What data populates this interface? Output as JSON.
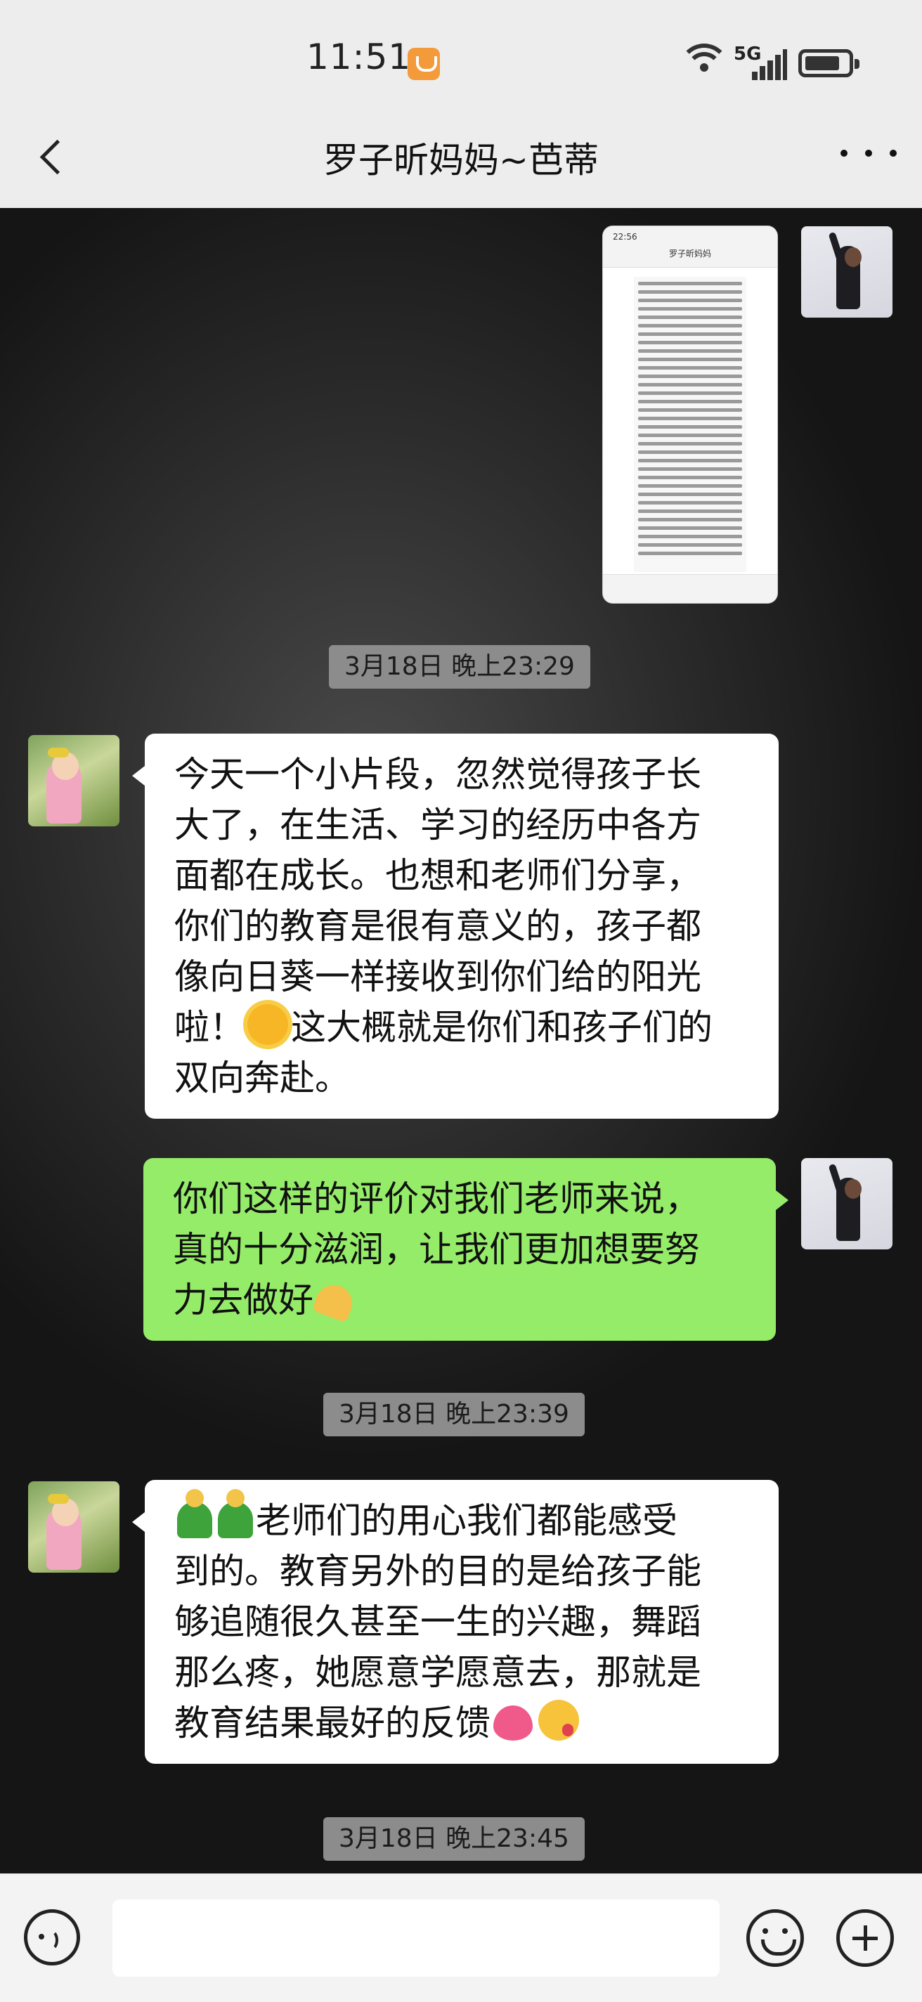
{
  "status_bar": {
    "time": "11:51",
    "network_label": "5G",
    "icons": [
      "clock-app-badge-icon",
      "wifi-icon",
      "signal-icon",
      "battery-icon"
    ]
  },
  "header": {
    "title": "罗子昕妈妈~芭蒂",
    "back_icon": "chevron-left-icon",
    "more_icon": "more-dots-icon"
  },
  "messages": [
    {
      "id": "m1",
      "side": "right",
      "type": "image",
      "image": {
        "time": "22:56",
        "title": "罗子昕妈妈"
      }
    },
    {
      "id": "t1",
      "type": "timestamp",
      "text": "3月18日 晚上23:29"
    },
    {
      "id": "m2",
      "side": "left",
      "type": "text",
      "lines": [
        "今天一个小片段，忽然觉得孩子长",
        "大了，在生活、学习的经历中各方",
        "面都在成长。也想和老师们分享，",
        "你们的教育是很有意义的，孩子都",
        "像向日葵一样接收到你们给的阳光",
        "啦！",
        "这大概就是你们和孩子们的",
        "双向奔赴。"
      ]
    },
    {
      "id": "m3",
      "side": "right",
      "type": "text",
      "lines": [
        "你们这样的评价对我们老师来说，",
        "真的十分滋润，让我们更加想要努",
        "力去做好"
      ]
    },
    {
      "id": "t2",
      "type": "timestamp",
      "text": "3月18日 晚上23:39"
    },
    {
      "id": "m4",
      "side": "left",
      "type": "text",
      "lines": [
        "老师们的用心我们都能感受",
        "到的。教育另外的目的是给孩子能",
        "够追随很久甚至一生的兴趣，舞蹈",
        "那么疼，她愿意学愿意去，那就是",
        "教育结果最好的反馈"
      ]
    },
    {
      "id": "t3",
      "type": "timestamp",
      "text": "3月18日 晚上23:45"
    }
  ],
  "input_bar": {
    "voice_icon": "voice-icon",
    "placeholder": "",
    "emoji_icon": "emoji-icon",
    "plus_icon": "plus-icon"
  },
  "colors": {
    "sent_bubble": "#95ec69",
    "received_bubble": "#ffffff",
    "header_bg": "#ededed",
    "timestamp_bg": "#8c8c8c"
  }
}
